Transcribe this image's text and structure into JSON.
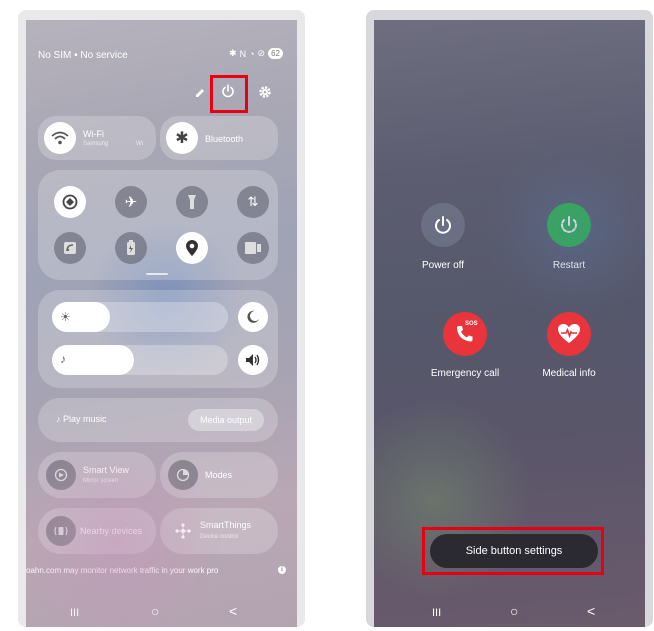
{
  "left_phone": {
    "status": {
      "carrier": "No SIM • No service",
      "battery": "62"
    },
    "wifi": {
      "label": "Wi-Fi",
      "sub1": "Samsung",
      "sub2": "Wi"
    },
    "bluetooth": {
      "label": "Bluetooth"
    },
    "play_music": "Play music",
    "media_output": "Media output",
    "smart_view": {
      "label": "Smart View",
      "sub": "Mirror screen"
    },
    "modes": {
      "label": "Modes"
    },
    "nearby": {
      "label": "Nearby devices"
    },
    "smartthings": {
      "label": "SmartThings",
      "sub": "Device control"
    },
    "notice": "oahn.com may monitor network traffic in your work pro",
    "nav": {
      "recents": "III",
      "home": "○",
      "back": "<"
    }
  },
  "right_phone": {
    "power_off": "Power off",
    "restart": "Restart",
    "emergency_call": "Emergency call",
    "sos": "SOS",
    "medical_info": "Medical info",
    "side_button_settings": "Side button settings",
    "nav": {
      "recents": "III",
      "home": "○",
      "back": "<"
    }
  },
  "colors": {
    "highlight": "#e60012",
    "restart_green": "#2db24a",
    "emergency_red": "#e8343a"
  }
}
